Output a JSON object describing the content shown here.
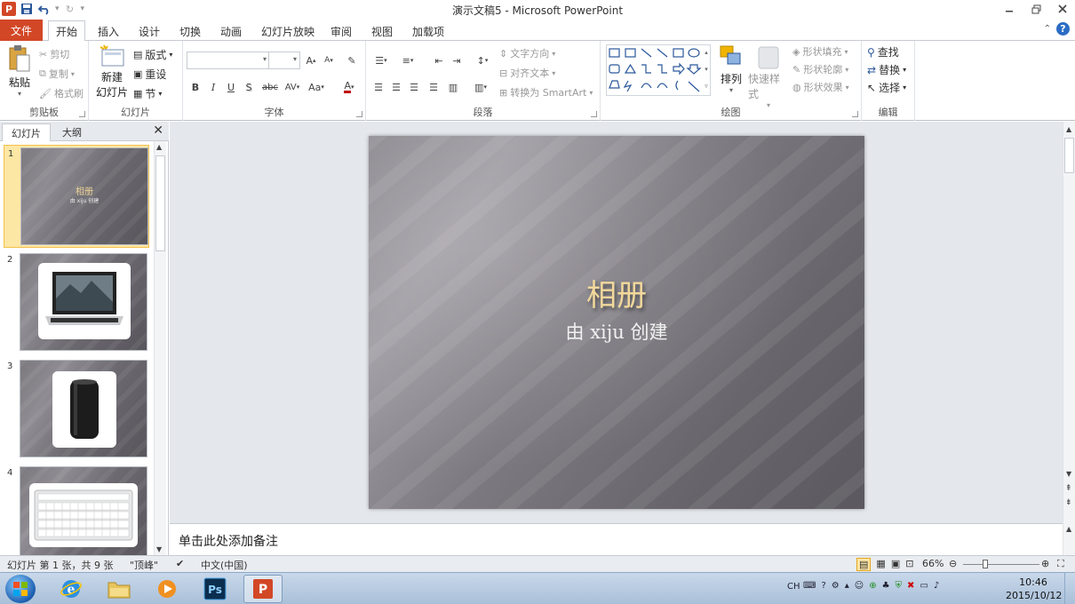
{
  "window": {
    "title": "演示文稿5 - Microsoft PowerPoint",
    "app_icon": "P"
  },
  "tabs": {
    "file": "文件",
    "items": [
      "开始",
      "插入",
      "设计",
      "切换",
      "动画",
      "幻灯片放映",
      "审阅",
      "视图",
      "加载项"
    ],
    "active": "开始"
  },
  "ribbon": {
    "clipboard": {
      "label": "剪贴板",
      "paste": "粘贴",
      "cut": "剪切",
      "copy": "复制",
      "format_painter": "格式刷"
    },
    "slides": {
      "label": "幻灯片",
      "new_slide_1": "新建",
      "new_slide_2": "幻灯片",
      "layout": "版式",
      "reset": "重设",
      "section": "节"
    },
    "font": {
      "label": "字体",
      "bold": "B",
      "italic": "I",
      "underline": "U",
      "shadow": "S",
      "strike": "abc",
      "spacing": "AV",
      "case": "Aa",
      "color": "A",
      "grow": "A",
      "shrink": "A"
    },
    "paragraph": {
      "label": "段落",
      "text_direction": "文字方向",
      "align_text": "对齐文本",
      "smartart": "转换为 SmartArt"
    },
    "drawing": {
      "label": "绘图",
      "arrange": "排列",
      "quick_styles": "快速样式",
      "shape_fill": "形状填充",
      "shape_outline": "形状轮廓",
      "shape_effects": "形状效果"
    },
    "editing": {
      "label": "编辑",
      "find": "查找",
      "replace": "替换",
      "select": "选择"
    }
  },
  "left_pane": {
    "tab_slides": "幻灯片",
    "tab_outline": "大纲",
    "thumbnails": [
      {
        "num": "1",
        "title": "相册",
        "subtitle": "由 xiju 创建",
        "content": "title"
      },
      {
        "num": "2",
        "content": "laptop"
      },
      {
        "num": "3",
        "content": "mac-pro"
      },
      {
        "num": "4",
        "content": "keyboard"
      }
    ],
    "selected": "1"
  },
  "slide": {
    "title": "相册",
    "subtitle": "由 xiju 创建",
    "title_color": "#f2d89b"
  },
  "notes": {
    "placeholder": "单击此处添加备注"
  },
  "statusbar": {
    "slide_info": "幻灯片 第 1 张，共 9 张",
    "theme": "\"顶峰\"",
    "language": "中文(中国)",
    "zoom": "66%"
  },
  "taskbar": {
    "ime": "CH",
    "time": "10:46",
    "date": "2015/10/12"
  },
  "colors": {
    "file_tab": "#d24726",
    "accent": "#2b579a"
  }
}
